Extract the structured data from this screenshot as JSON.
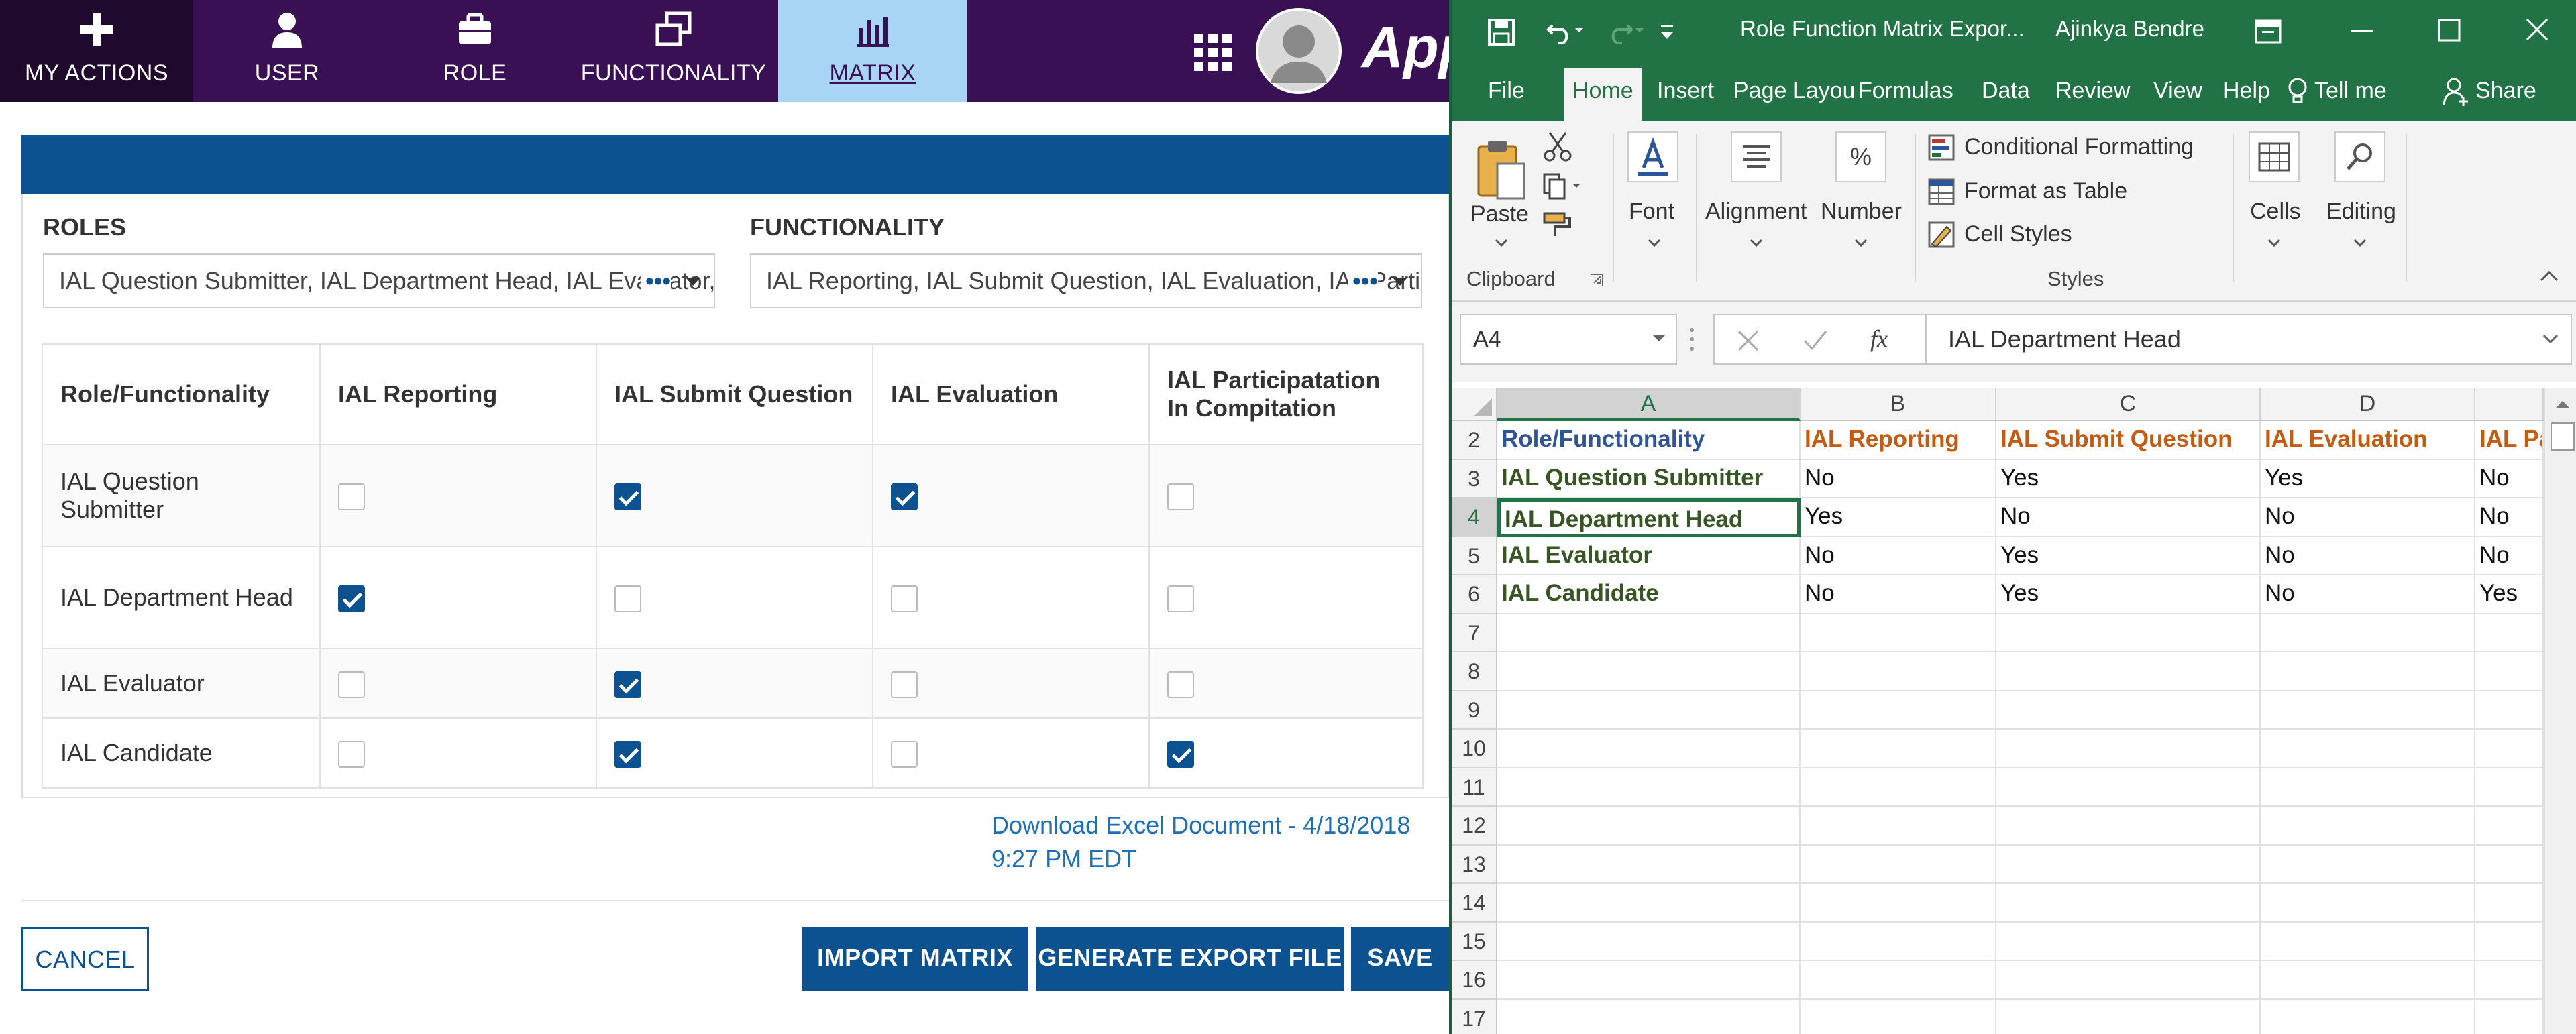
{
  "app": {
    "nav": [
      {
        "label": "MY ACTIONS",
        "icon": "plus-icon"
      },
      {
        "label": "USER",
        "icon": "user-icon"
      },
      {
        "label": "ROLE",
        "icon": "briefcase-icon"
      },
      {
        "label": "FUNCTIONALITY",
        "icon": "windows-icon"
      },
      {
        "label": "MATRIX",
        "icon": "bar-chart-icon"
      }
    ],
    "grid_icon": "apps-grid-icon",
    "brand_text": "Appi",
    "filters": {
      "roles_label": "ROLES",
      "roles_value": "IAL Question Submitter, IAL Department Head, IAL Evaluator, IAL Candidate",
      "functionality_label": "FUNCTIONALITY",
      "functionality_value": "IAL Reporting, IAL Submit Question, IAL Evaluation, IAL Participatation In Compitation",
      "more": "•••"
    },
    "matrix": {
      "headers": [
        "Role/Functionality",
        "IAL Reporting",
        "IAL Submit Question",
        "IAL Evaluation",
        "IAL Participatation In Compitation"
      ],
      "rows": [
        {
          "role": "IAL Question Submitter",
          "checks": [
            false,
            true,
            true,
            false
          ]
        },
        {
          "role": "IAL Department Head",
          "checks": [
            true,
            false,
            false,
            false
          ]
        },
        {
          "role": "IAL Evaluator",
          "checks": [
            false,
            true,
            false,
            false
          ]
        },
        {
          "role": "IAL Candidate",
          "checks": [
            false,
            true,
            false,
            true
          ]
        }
      ]
    },
    "download_link": "Download Excel Document - 4/18/2018 9:27 PM EDT",
    "buttons": {
      "cancel": "CANCEL",
      "import": "IMPORT MATRIX",
      "export": "GENERATE EXPORT FILE",
      "save": "SAVE"
    }
  },
  "excel": {
    "title": "Role Function Matrix Expor...",
    "user": "Ajinkya Bendre",
    "tabs": [
      "File",
      "Home",
      "Insert",
      "Page Layou",
      "Formulas",
      "Data",
      "Review",
      "View",
      "Help"
    ],
    "active_tab": "Home",
    "tell_me": "Tell me",
    "share": "Share",
    "ribbon": {
      "paste": "Paste",
      "clipboard": "Clipboard",
      "font": "Font",
      "alignment": "Alignment",
      "number": "Number",
      "conditional_formatting": "Conditional Formatting",
      "format_as_table": "Format as Table",
      "cell_styles": "Cell Styles",
      "styles": "Styles",
      "cells": "Cells",
      "editing": "Editing"
    },
    "name_box": "A4",
    "formula": "IAL Department Head",
    "fx": "fx",
    "columns": [
      "A",
      "B",
      "C",
      "D"
    ],
    "row_numbers": [
      "2",
      "3",
      "4",
      "5",
      "6",
      "7",
      "8",
      "9",
      "10",
      "11",
      "12",
      "13",
      "14",
      "15",
      "16",
      "17"
    ],
    "sheet": [
      [
        "Role/Functionality",
        "IAL Reporting",
        "IAL Submit Question",
        "IAL Evaluation",
        "IAL Par"
      ],
      [
        "IAL Question Submitter",
        "No",
        "Yes",
        "Yes",
        "No"
      ],
      [
        "IAL Department Head",
        "Yes",
        "No",
        "No",
        "No"
      ],
      [
        "IAL Evaluator",
        "No",
        "Yes",
        "No",
        "No"
      ],
      [
        "IAL Candidate",
        "No",
        "Yes",
        "No",
        "Yes"
      ]
    ],
    "colors": {
      "excel_green": "#217346",
      "header_text": "#c55a11",
      "role_text": "#375623",
      "app_purple": "#3a1054",
      "app_blue": "#0d5290"
    }
  }
}
